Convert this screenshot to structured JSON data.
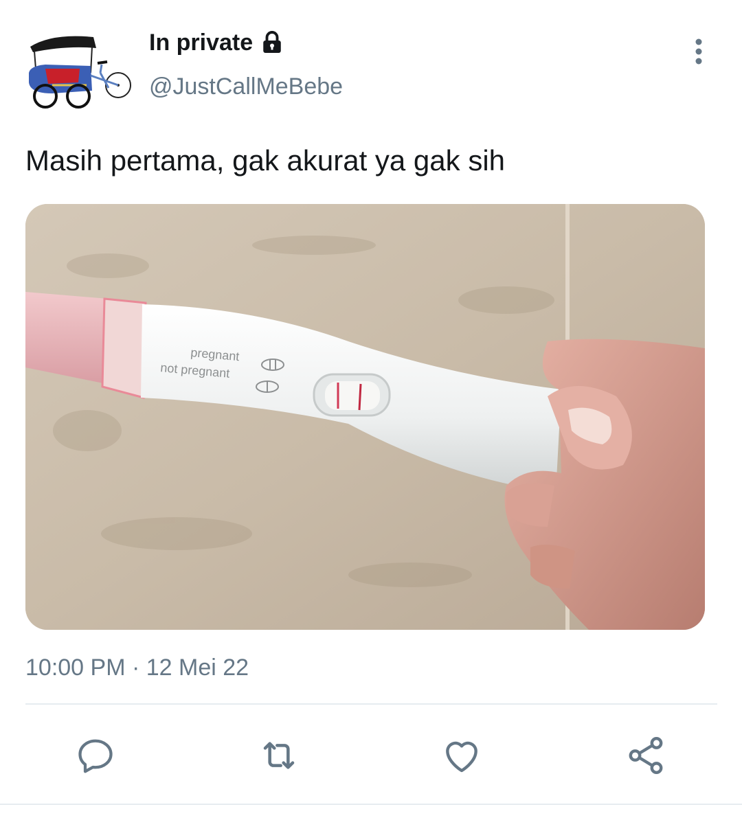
{
  "tweet": {
    "display_name": "In private",
    "handle": "@JustCallMeBebe",
    "text": "Masih pertama, gak akurat ya gak sih",
    "timestamp": "10:00 PM · 12 Mei 22"
  },
  "media": {
    "label_pregnant": "pregnant",
    "label_not_pregnant": "not pregnant"
  },
  "icons": {
    "avatar": "becak-avatar",
    "lock": "lock-icon",
    "more": "more-vertical-icon",
    "reply": "reply-icon",
    "retweet": "retweet-icon",
    "like": "heart-icon",
    "share": "share-icon"
  },
  "colors": {
    "primary_text": "#14171a",
    "secondary_text": "#657786",
    "divider": "#e6ecf0",
    "action_icon": "#657786"
  }
}
